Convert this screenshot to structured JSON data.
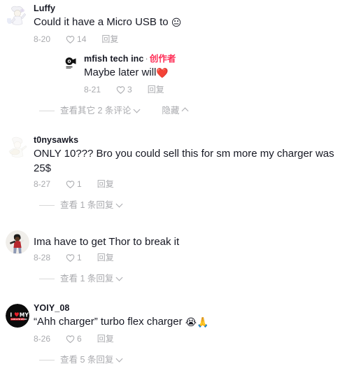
{
  "theme": {
    "background": "#ffffff",
    "text_primary": "#161823",
    "text_muted": "#A9AAAE",
    "accent_creator": "#FE2C55",
    "divider": "#D8D8D8"
  },
  "comments": [
    {
      "id": "comment-luffy",
      "username": "Luffy",
      "avatar_name": "avatar-luffy",
      "content": "Could it have a Micro USB to ",
      "content_emoji": "😐",
      "content_emoji_name": "expressionless-face-emoji",
      "date": "8-20",
      "like_count": "14",
      "reply_label": "回复",
      "replies": [
        {
          "id": "reply-mfish",
          "username": "mfish tech inc",
          "separator": "·",
          "badge": "创作者",
          "avatar_name": "avatar-mfish-tech-inc",
          "content": "Maybe later will",
          "content_emoji": "❤️",
          "content_emoji_name": "red-heart-emoji",
          "date": "8-21",
          "like_count": "3",
          "reply_label": "回复"
        }
      ],
      "expander": {
        "label": "查看其它 2 条评论",
        "chevron": "chevron-down-icon",
        "hide_label": "隐藏",
        "hide_chevron": "chevron-up-icon"
      }
    },
    {
      "id": "comment-t0nysawks",
      "username": "t0nysawks",
      "avatar_name": "avatar-t0nysawks",
      "content": "ONLY 10??? Bro you could sell this for sm more my charger was 25$",
      "content_emoji": "",
      "content_emoji_name": "",
      "date": "8-27",
      "like_count": "1",
      "reply_label": "回复",
      "replies": [],
      "expander": {
        "label": "查看 1 条回复",
        "chevron": "chevron-down-icon",
        "hide_label": "",
        "hide_chevron": ""
      }
    },
    {
      "id": "comment-thor",
      "username": "",
      "avatar_name": "avatar-thor-user",
      "content": "Ima have to get Thor to break it",
      "content_emoji": "",
      "content_emoji_name": "",
      "date": "8-28",
      "like_count": "1",
      "reply_label": "回复",
      "replies": [],
      "expander": {
        "label": "查看 1 条回复",
        "chevron": "chevron-down-icon",
        "hide_label": "",
        "hide_chevron": ""
      }
    },
    {
      "id": "comment-yoiy08",
      "username": "YOIY_08",
      "avatar_name": "avatar-yoiy-08",
      "content": "“Ahh charger” turbo flex charger ",
      "content_emoji": "😭🙏",
      "content_emoji_name": "loudly-crying-face-and-folded-hands-emoji",
      "date": "8-26",
      "like_count": "6",
      "reply_label": "回复",
      "replies": [],
      "expander": {
        "label": "查看 5 条回复",
        "chevron": "chevron-down-icon",
        "hide_label": "",
        "hide_chevron": ""
      }
    }
  ],
  "icons": {
    "heart": "heart-outline-icon",
    "chevron_down": "chevron-down-icon",
    "chevron_up": "chevron-up-icon"
  },
  "avatars": {
    "avatar_mfish_label": "mfish"
  }
}
